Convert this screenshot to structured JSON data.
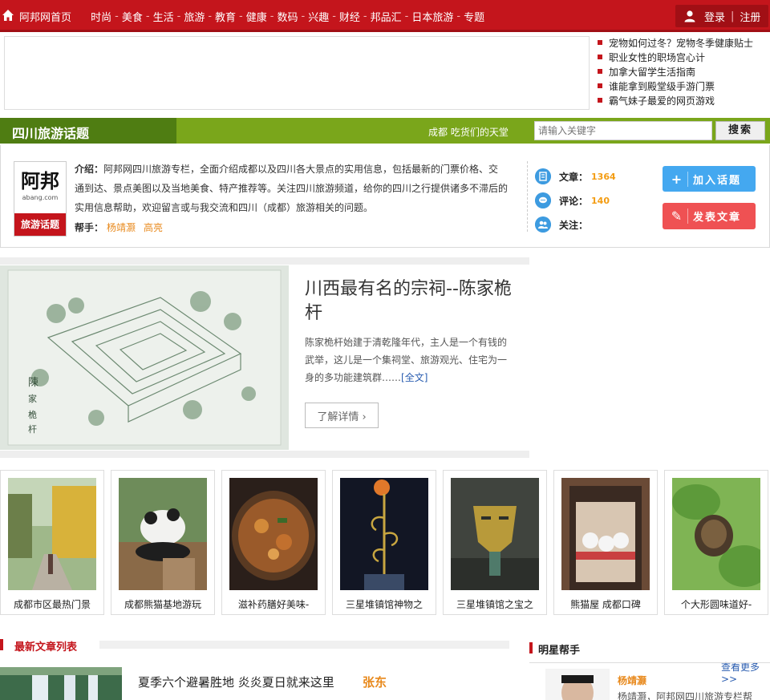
{
  "nav": {
    "home": "阿邦网首页",
    "items": [
      "时尚",
      "美食",
      "生活",
      "旅游",
      "教育",
      "健康",
      "数码",
      "兴趣",
      "财经",
      "邦品汇",
      "日本旅游",
      "专题"
    ],
    "login": "登录",
    "register": "注册"
  },
  "headlines": [
    "宠物如何过冬？宠物冬季健康贴士",
    "职业女性的职场宫心计",
    "加拿大留学生活指南",
    "谁能拿到殿堂级手游门票",
    "霸气妹子最爱的网页游戏"
  ],
  "banner": {
    "title": "四川旅游话题",
    "slogan": "成都  吃货们的天堂",
    "search_placeholder": "请输入关键字",
    "search_button": "搜索"
  },
  "intro": {
    "logo_text": "阿邦",
    "logo_sub": "abang.com",
    "logo_badge": "旅游话题",
    "label": "介绍：",
    "text": "阿邦网四川旅游专栏，全面介绍成都以及四川各大景点的实用信息，包括最新的门票价格、交通到达、景点美图以及当地美食、特产推荐等。关注四川旅游频道，给你的四川之行提供诸多不滞后的实用信息帮助，欢迎留言或与我交流和四川（成都）旅游相关的问题。",
    "helpers_label": "帮手：",
    "helpers": [
      "杨靖灏",
      "高亮"
    ],
    "stats": {
      "articles_label": "文章：",
      "articles": "1364",
      "comments_label": "评论：",
      "comments": "140",
      "follow_label": "关注："
    },
    "join_button": "加入话题",
    "post_button": "发表文章"
  },
  "feature": {
    "title": "川西最有名的宗祠--陈家桅杆",
    "desc": "陈家桅杆始建于清乾隆年代，主人是一个有钱的武举，这儿是一个集祠堂、旅游观光、住宅为一身的多功能建筑群……",
    "more": "[全文]",
    "button": "了解详情 ›"
  },
  "thumbs": [
    {
      "caption": "成都市区最热门景"
    },
    {
      "caption": "成都熊猫基地游玩"
    },
    {
      "caption": "滋补药膳好美味-"
    },
    {
      "caption": "三星堆镇馆神物之"
    },
    {
      "caption": "三星堆镇馆之宝之"
    },
    {
      "caption": "熊猫屋 成都口碑"
    },
    {
      "caption": "个大形圆味道好-"
    }
  ],
  "latest": {
    "title": "最新文章列表",
    "article_title": "夏季六个避暑胜地  炎炎夏日就来这里",
    "article_author": "张东"
  },
  "star": {
    "title": "明星帮手",
    "see_more": "查看更多>>",
    "name": "杨靖灏",
    "desc": "杨靖灏，阿邦网四川旅游专栏帮"
  },
  "colors": {
    "brand_red": "#c4151c",
    "green": "#7aa61b",
    "dark_green": "#4f7d12",
    "orange": "#e8891c",
    "blue": "#44a8f0",
    "coral": "#ef5153"
  }
}
